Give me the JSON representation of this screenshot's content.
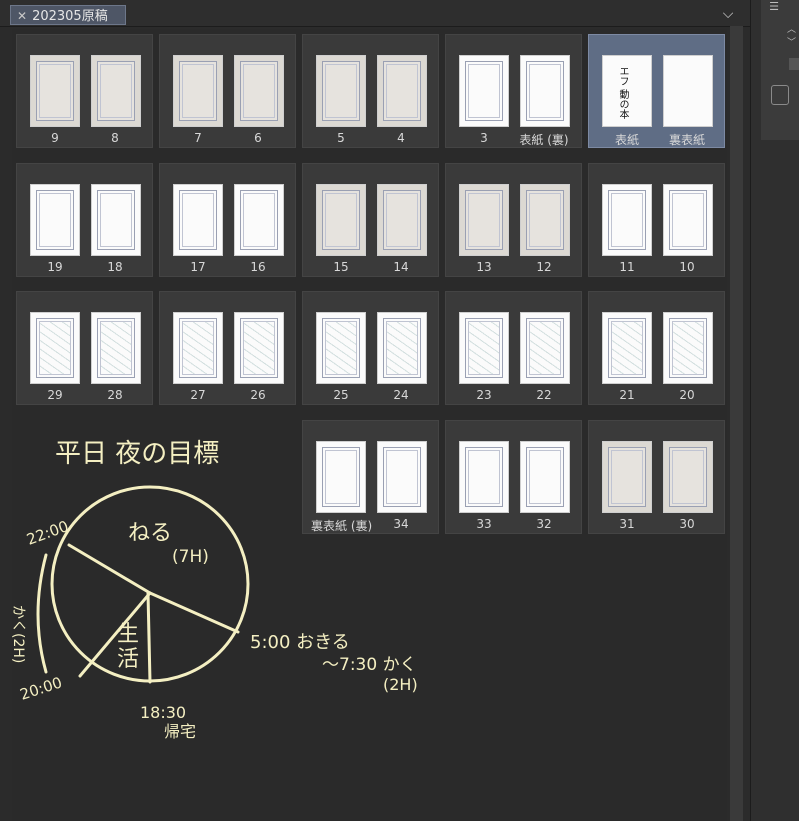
{
  "tab": {
    "title": "202305原稿",
    "close": "✕"
  },
  "collapse_icon": "⌵",
  "right_panel": {
    "menu": "☰",
    "up": "︿",
    "down": "﹀"
  },
  "spreads": [
    {
      "left": "9",
      "right": "8",
      "style": "gray"
    },
    {
      "left": "7",
      "right": "6",
      "style": "gray"
    },
    {
      "left": "5",
      "right": "4",
      "style": "gray"
    },
    {
      "left": "3",
      "right": "表紙 (裏)",
      "style": "blank"
    },
    {
      "left": "表紙",
      "right": "裏表紙",
      "style": "cover",
      "selected": true,
      "cover_text": "エフ 動の本"
    },
    {
      "left": "19",
      "right": "18",
      "style": "blank"
    },
    {
      "left": "17",
      "right": "16",
      "style": "light"
    },
    {
      "left": "15",
      "right": "14",
      "style": "gray"
    },
    {
      "left": "13",
      "right": "12",
      "style": "gray"
    },
    {
      "left": "11",
      "right": "10",
      "style": "light"
    },
    {
      "left": "29",
      "right": "28",
      "style": "sketch"
    },
    {
      "left": "27",
      "right": "26",
      "style": "sketch"
    },
    {
      "left": "25",
      "right": "24",
      "style": "sketch"
    },
    {
      "left": "23",
      "right": "22",
      "style": "sketch"
    },
    {
      "left": "21",
      "right": "20",
      "style": "sketch"
    },
    {
      "left": "裏表紙 (裏)",
      "right": "34",
      "style": "blank"
    },
    {
      "left": "33",
      "right": "32",
      "style": "blank"
    },
    {
      "left": "31",
      "right": "30",
      "style": "gray"
    }
  ],
  "note": {
    "title": "平日 夜の目標",
    "sleep": "ねる",
    "sleep_hours": "(7H)",
    "life_1": "生",
    "life_2": "活",
    "t_2200": "22:00",
    "t_2000": "20:00",
    "t_1830": "18:30",
    "home": "帰宅",
    "t_500": "5:00 おきる",
    "t_730": "〜7:30 かく",
    "t_2h": "(2H)",
    "draw_side": "かく(2H)"
  }
}
